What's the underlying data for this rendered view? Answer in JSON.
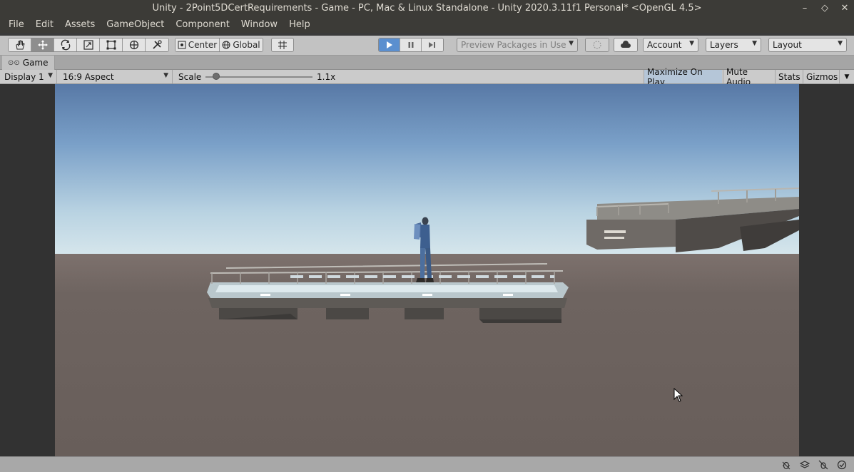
{
  "window": {
    "title": "Unity - 2Point5DCertRequirements - Game - PC, Mac & Linux Standalone - Unity 2020.3.11f1 Personal* <OpenGL 4.5>",
    "controls": {
      "minimize": "–",
      "maximize": "◇",
      "close": "✕"
    }
  },
  "menu": [
    "File",
    "Edit",
    "Assets",
    "GameObject",
    "Component",
    "Window",
    "Help"
  ],
  "toolbar": {
    "tools": [
      "hand-tool",
      "move-tool",
      "rotate-tool",
      "scale-tool",
      "rect-tool",
      "transform-tool",
      "custom-tool"
    ],
    "pivot_label": "Center",
    "space_label": "Global",
    "preview_packages": "Preview Packages in Use",
    "account": "Account",
    "layers": "Layers",
    "layout": "Layout",
    "play_state": "playing"
  },
  "tab": {
    "label": "Game"
  },
  "game_toolbar": {
    "display": "Display 1",
    "aspect": "16:9 Aspect",
    "scale_label": "Scale",
    "scale_value": "1.1x",
    "maximize_on_play": "Maximize On Play",
    "mute_audio": "Mute Audio",
    "stats": "Stats",
    "gizmos": "Gizmos"
  },
  "colors": {
    "play_active": "#5b8fcf",
    "sky_top": "#5879a6",
    "sky_horizon": "#d6e6ec",
    "ground": "#6c625e"
  }
}
